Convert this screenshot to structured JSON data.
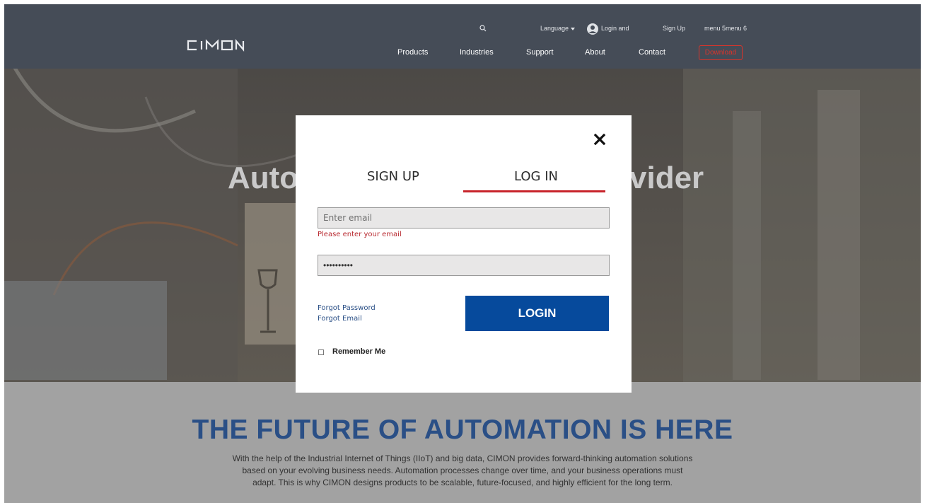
{
  "header": {
    "logo_text": "CIMON",
    "search_icon": "search-icon",
    "language_label": "Language",
    "login_label": "Login and",
    "signup_label": "Sign Up",
    "menu56_label": "menu 5menu 6",
    "nav": {
      "products": "Products",
      "industries": "Industries",
      "support": "Support",
      "about": "About",
      "contact": "Contact"
    },
    "download_label": "Download"
  },
  "hero": {
    "left_text": "Auto",
    "right_text": "vider"
  },
  "lower": {
    "title": "THE FUTURE OF AUTOMATION IS HERE",
    "body": "With the help of the Industrial Internet of Things (IIoT) and big data, CIMON provides forward-thinking automation solutions based on your evolving business needs. Automation processes change over time, and your business operations must adapt. This is why CIMON designs products to be scalable, future-focused, and highly efficient for the long term."
  },
  "modal": {
    "close_label": "X",
    "tabs": {
      "signup": "SIGN UP",
      "login": "LOG IN"
    },
    "active_tab": "login",
    "email_placeholder": "Enter email",
    "email_error": "Please enter your email",
    "password_value": "••••••••••",
    "forgot_password": "Forgot Password",
    "forgot_email": "Forgot Email",
    "login_button": "LOGIN",
    "remember_me": "Remember Me"
  },
  "colors": {
    "header_bg": "#454c57",
    "accent_red": "#c8242b",
    "brand_blue": "#064a9c",
    "title_blue": "#2a4f86"
  }
}
